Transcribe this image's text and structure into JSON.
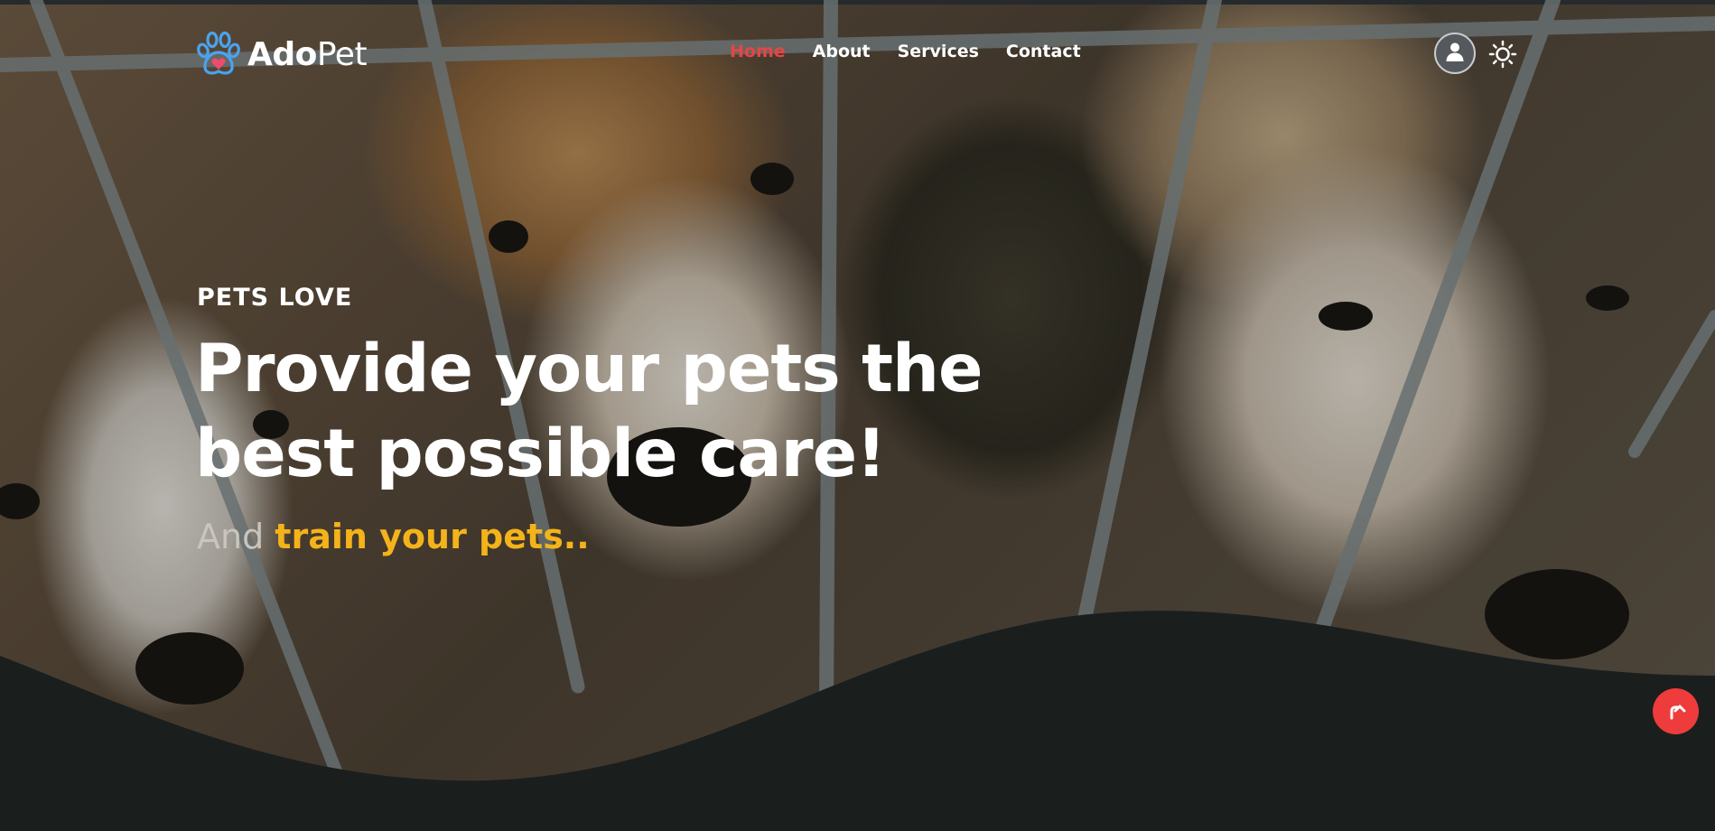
{
  "brand": {
    "name_bold": "Ado",
    "name_light": "Pet",
    "logo_icon": "paw-heart-icon"
  },
  "nav": {
    "items": [
      {
        "label": "Home",
        "active": true
      },
      {
        "label": "About",
        "active": false
      },
      {
        "label": "Services",
        "active": false
      },
      {
        "label": "Contact",
        "active": false
      }
    ]
  },
  "header_actions": {
    "user_icon": "user-icon",
    "theme_icon": "sun-icon"
  },
  "hero": {
    "eyebrow": "PETS LOVE",
    "headline_line1": "Provide your pets the",
    "headline_line2": "best possible care!",
    "sub_prefix": "And",
    "sub_highlight": "train your pets.."
  },
  "scroll_top": {
    "icon": "arrow-up-icon"
  },
  "colors": {
    "accent_red": "#e84545",
    "accent_yellow": "#f4b31a",
    "dark_bg": "#1a1f1e",
    "logo_blue": "#4aa3ee",
    "logo_heart": "#ef4b6c"
  }
}
